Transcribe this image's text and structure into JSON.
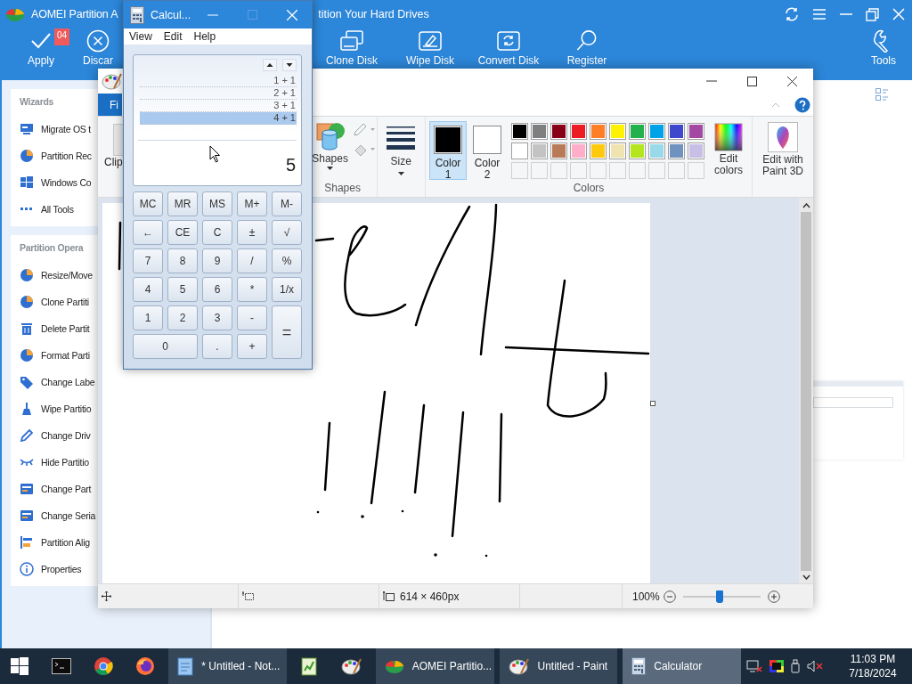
{
  "aomei": {
    "title_parts": [
      "AOMEI Partition A",
      "tition Your Hard Drives"
    ],
    "toolbar": [
      {
        "label": "Apply",
        "badge": "04"
      },
      {
        "label": "Discar"
      },
      {
        "label": "Clone Disk"
      },
      {
        "label": "Wipe Disk"
      },
      {
        "label": "Convert Disk"
      },
      {
        "label": "Register"
      },
      {
        "label": "Tools"
      }
    ],
    "sidebar": [
      {
        "heading": "Wizards",
        "items": [
          "Migrate OS t",
          "Partition Rec",
          "Windows Co",
          "All Tools"
        ]
      },
      {
        "heading": "Partition Opera",
        "items": [
          "Resize/Move",
          "Clone Partiti",
          "Delete Partit",
          "Format Parti",
          "Change Labe",
          "Wipe Partitio",
          "Change Driv",
          "Hide Partitio",
          "Change Part",
          "Change Seria",
          "Partition Alig",
          "Properties"
        ]
      }
    ]
  },
  "paint": {
    "tabs": [
      {
        "label": "Fi",
        "selected": true
      }
    ],
    "clipboard_label": "Clip",
    "shapes_button": "Shapes",
    "size_button": "Size",
    "color_slots": [
      {
        "label": "Color 1",
        "selected": true,
        "color": "#000000"
      },
      {
        "label": "Color 2",
        "selected": false,
        "color": "#ffffff"
      }
    ],
    "palette": [
      {
        "kind": "swatch",
        "color": "#000000"
      },
      {
        "kind": "swatch",
        "color": "#7f7f7f"
      },
      {
        "kind": "swatch",
        "color": "#880015"
      },
      {
        "kind": "swatch",
        "color": "#ed1c24"
      },
      {
        "kind": "swatch",
        "color": "#ff7f27"
      },
      {
        "kind": "swatch",
        "color": "#fff200"
      },
      {
        "kind": "swatch",
        "color": "#22b14c"
      },
      {
        "kind": "swatch",
        "color": "#00a2e8"
      },
      {
        "kind": "swatch",
        "color": "#3f48cc"
      },
      {
        "kind": "swatch",
        "color": "#a349a4"
      },
      {
        "kind": "swatch",
        "color": "#ffffff"
      },
      {
        "kind": "swatch",
        "color": "#c3c3c3"
      },
      {
        "kind": "swatch",
        "color": "#b97a57"
      },
      {
        "kind": "swatch",
        "color": "#ffaec9"
      },
      {
        "kind": "swatch",
        "color": "#ffc90e"
      },
      {
        "kind": "swatch",
        "color": "#efe4b0"
      },
      {
        "kind": "swatch",
        "color": "#b5e61d"
      },
      {
        "kind": "swatch",
        "color": "#99d9ea"
      },
      {
        "kind": "swatch",
        "color": "#7092be"
      },
      {
        "kind": "swatch",
        "color": "#c8bfe7"
      },
      {
        "kind": "empty"
      },
      {
        "kind": "empty"
      },
      {
        "kind": "empty"
      },
      {
        "kind": "empty"
      },
      {
        "kind": "empty"
      },
      {
        "kind": "empty"
      },
      {
        "kind": "empty"
      },
      {
        "kind": "empty"
      },
      {
        "kind": "empty"
      },
      {
        "kind": "empty"
      }
    ],
    "edit_colors": "Edit colors",
    "paint3d": "Edit with Paint 3D",
    "group_labels": [
      "Shapes",
      "Colors"
    ],
    "status": {
      "dimensions": "614 × 460px",
      "zoom": "100%",
      "slider": {
        "level": 0.48
      }
    }
  },
  "calculator": {
    "title": "Calcul...",
    "menu": [
      "View",
      "Edit",
      "Help"
    ],
    "history": [
      {
        "text": "1 + 1",
        "selected": false
      },
      {
        "text": "2 + 1",
        "selected": false
      },
      {
        "text": "3 + 1",
        "selected": false
      },
      {
        "text": "4 + 1",
        "selected": true
      }
    ],
    "result": "5",
    "keys": [
      {
        "label": "MC",
        "kind": "normal"
      },
      {
        "label": "MR",
        "kind": "normal"
      },
      {
        "label": "MS",
        "kind": "normal"
      },
      {
        "label": "M+",
        "kind": "normal"
      },
      {
        "label": "M-",
        "kind": "normal"
      },
      {
        "label": "←",
        "kind": "normal"
      },
      {
        "label": "CE",
        "kind": "normal"
      },
      {
        "label": "C",
        "kind": "normal"
      },
      {
        "label": "±",
        "kind": "normal"
      },
      {
        "label": "√",
        "kind": "normal"
      },
      {
        "label": "7",
        "kind": "normal"
      },
      {
        "label": "8",
        "kind": "normal"
      },
      {
        "label": "9",
        "kind": "normal"
      },
      {
        "label": "/",
        "kind": "normal"
      },
      {
        "label": "%",
        "kind": "normal"
      },
      {
        "label": "4",
        "kind": "normal"
      },
      {
        "label": "5",
        "kind": "normal"
      },
      {
        "label": "6",
        "kind": "normal"
      },
      {
        "label": "*",
        "kind": "normal"
      },
      {
        "label": "1/x",
        "kind": "normal"
      },
      {
        "label": "1",
        "kind": "normal"
      },
      {
        "label": "2",
        "kind": "normal"
      },
      {
        "label": "3",
        "kind": "normal"
      },
      {
        "label": "-",
        "kind": "normal"
      },
      {
        "label": "=",
        "kind": "tall"
      },
      {
        "label": "0",
        "kind": "wide"
      },
      {
        "label": ".",
        "kind": "normal"
      },
      {
        "label": "+",
        "kind": "normal"
      }
    ]
  },
  "taskbar": {
    "items": [
      {
        "kind": "pinned"
      },
      {
        "kind": "pinned"
      },
      {
        "kind": "pinned"
      },
      {
        "kind": "pinned"
      },
      {
        "kind": "window",
        "label": "* Untitled - Not...",
        "selected": false
      },
      {
        "kind": "pinned"
      },
      {
        "kind": "pinned"
      },
      {
        "kind": "window",
        "label": "AOMEI Partitio...",
        "selected": false
      },
      {
        "kind": "window",
        "label": "Untitled - Paint",
        "selected": false
      },
      {
        "kind": "window",
        "label": "Calculator",
        "selected": true
      }
    ],
    "time": "11:03 PM",
    "date": "7/18/2024"
  }
}
